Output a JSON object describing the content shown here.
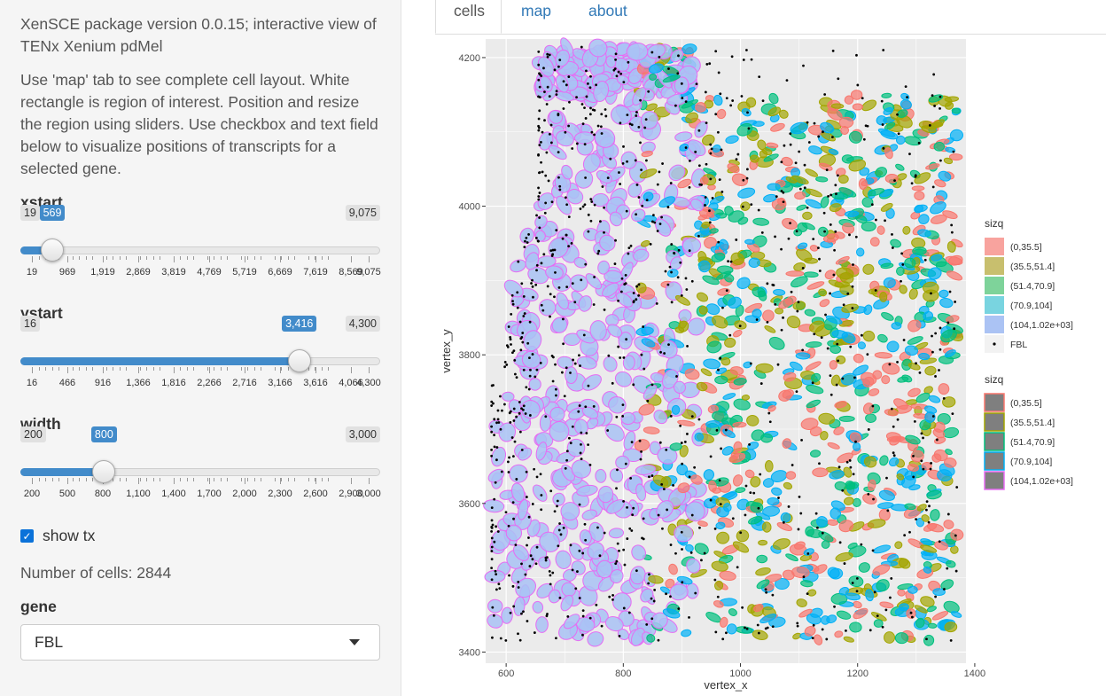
{
  "sidebar": {
    "intro1": "XenSCE package version 0.0.15; interactive view of TENx Xenium pdMel",
    "intro2": "Use 'map' tab to see complete cell layout. White rectangle is region of interest. Position and resize the region using sliders. Use checkbox and text field below to visualize positions of transcripts for a selected gene.",
    "sliders": {
      "xstart": {
        "label": "xstart",
        "min": 19,
        "max": 9075,
        "value": 569,
        "min_text": "19",
        "max_text": "9,075",
        "value_text": "569",
        "ticks": [
          "19",
          "969",
          "1,919",
          "2,869",
          "3,819",
          "4,769",
          "5,719",
          "6,669",
          "7,619",
          "8,569",
          "9,075"
        ]
      },
      "ystart": {
        "label": "ystart",
        "min": 16,
        "max": 4300,
        "value": 3416,
        "min_text": "16",
        "max_text": "4,300",
        "value_text": "3,416",
        "ticks": [
          "16",
          "466",
          "916",
          "1,366",
          "1,816",
          "2,266",
          "2,716",
          "3,166",
          "3,616",
          "4,066",
          "4,300"
        ]
      },
      "width": {
        "label": "width",
        "min": 200,
        "max": 3000,
        "value": 800,
        "min_text": "200",
        "max_text": "3,000",
        "value_text": "800",
        "ticks": [
          "200",
          "500",
          "800",
          "1,100",
          "1,400",
          "1,700",
          "2,000",
          "2,300",
          "2,600",
          "2,900",
          "3,000"
        ]
      }
    },
    "show_tx_label": "show tx",
    "show_tx_checked": true,
    "ncells_text": "Number of cells: 2844",
    "gene_label": "gene",
    "gene_value": "FBL"
  },
  "tabs": [
    {
      "label": "cells",
      "active": true
    },
    {
      "label": "map",
      "active": false
    },
    {
      "label": "about",
      "active": false
    }
  ],
  "chart_data": {
    "type": "scatter",
    "xlabel": "vertex_x",
    "ylabel": "vertex_y",
    "xlim": [
      565,
      1385
    ],
    "ylim": [
      3385,
      4225
    ],
    "xticks": [
      600,
      800,
      1000,
      1200,
      1400
    ],
    "yticks": [
      3400,
      3600,
      3800,
      4000,
      4200
    ],
    "grid": true,
    "legend_position": "right",
    "fill_legend": {
      "title": "sizq",
      "entries": [
        {
          "label": "(0,35.5]",
          "color": "#F8A39E"
        },
        {
          "label": "(35.5,51.4]",
          "color": "#C8BF6E"
        },
        {
          "label": "(51.4,70.9]",
          "color": "#7ED39A"
        },
        {
          "label": "(70.9,104]",
          "color": "#79D4E0"
        },
        {
          "label": "(104,1.02e+03]",
          "color": "#ABC3F4"
        },
        {
          "label": "FBL",
          "color": "#000000"
        }
      ]
    },
    "outline_legend": {
      "title": "sizq",
      "entries": [
        {
          "label": "(0,35.5]",
          "color": "#F8766D"
        },
        {
          "label": "(35.5,51.4]",
          "color": "#A3A500"
        },
        {
          "label": "(51.4,70.9]",
          "color": "#00BF7D"
        },
        {
          "label": "(70.9,104]",
          "color": "#00B0F6"
        },
        {
          "label": "(104,1.02e+03]",
          "color": "#E76BF3"
        }
      ]
    },
    "cell_fill_colors": [
      "#F8766D",
      "#A3A500",
      "#00BF7D",
      "#00B0F6",
      "#A9C2F5"
    ],
    "cell_outline_colors": [
      "#F8766D",
      "#A3A500",
      "#00BF7D",
      "#00B0F6",
      "#E76BF3"
    ]
  }
}
